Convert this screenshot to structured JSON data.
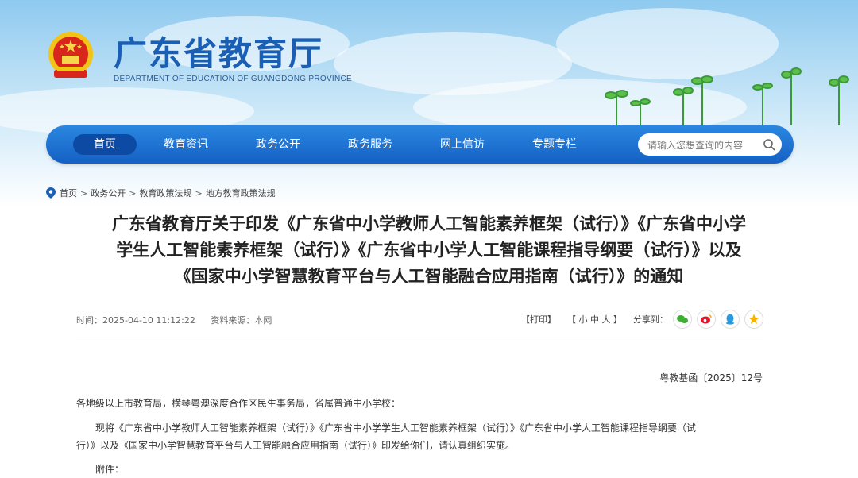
{
  "header": {
    "title": "广东省教育厅",
    "subtitle": "DEPARTMENT OF EDUCATION OF GUANGDONG PROVINCE"
  },
  "nav": {
    "items": [
      {
        "label": "首页",
        "active": true
      },
      {
        "label": "教育资讯"
      },
      {
        "label": "政务公开"
      },
      {
        "label": "政务服务"
      },
      {
        "label": "网上信访"
      },
      {
        "label": "专题专栏"
      }
    ],
    "search_placeholder": "请输入您想查询的内容"
  },
  "breadcrumb": [
    "首页",
    "政务公开",
    "教育政策法规",
    "地方教育政策法规"
  ],
  "article": {
    "title_lines": [
      "广东省教育厅关于印发《广东省中小学教师人工智能素养框架（试行）》《广东省中小学",
      "学生人工智能素养框架（试行）》《广东省中小学人工智能课程指导纲要（试行）》以及",
      "《国家中小学智慧教育平台与人工智能融合应用指南（试行）》的通知"
    ],
    "time_label": "时间：2025-04-10 11:12:22",
    "source_label": "资料来源：本网",
    "print": "【打印】",
    "font_size": "【 小  中  大 】",
    "share_label": "分享到：",
    "doc_number": "粤教基函〔2025〕12号",
    "salutation": "各地级以上市教育局，横琴粤澳深度合作区民生事务局，省属普通中小学校：",
    "body_line1": "现将《广东省中小学教师人工智能素养框架（试行）》《广东省中小学学生人工智能素养框架（试行）》《广东省中小学人工智能课程指导纲要（试",
    "body_line2": "行）》以及《国家中小学智慧教育平台与人工智能融合应用指南（试行）》印发给你们，请认真组织实施。",
    "attachment": "附件："
  },
  "colors": {
    "brand": "#1a5fb4",
    "nav": "#1560c4"
  },
  "icons": [
    "emblem-icon",
    "location-pin-icon",
    "search-icon",
    "wechat-icon",
    "weibo-icon",
    "qq-icon",
    "qzone-icon"
  ]
}
